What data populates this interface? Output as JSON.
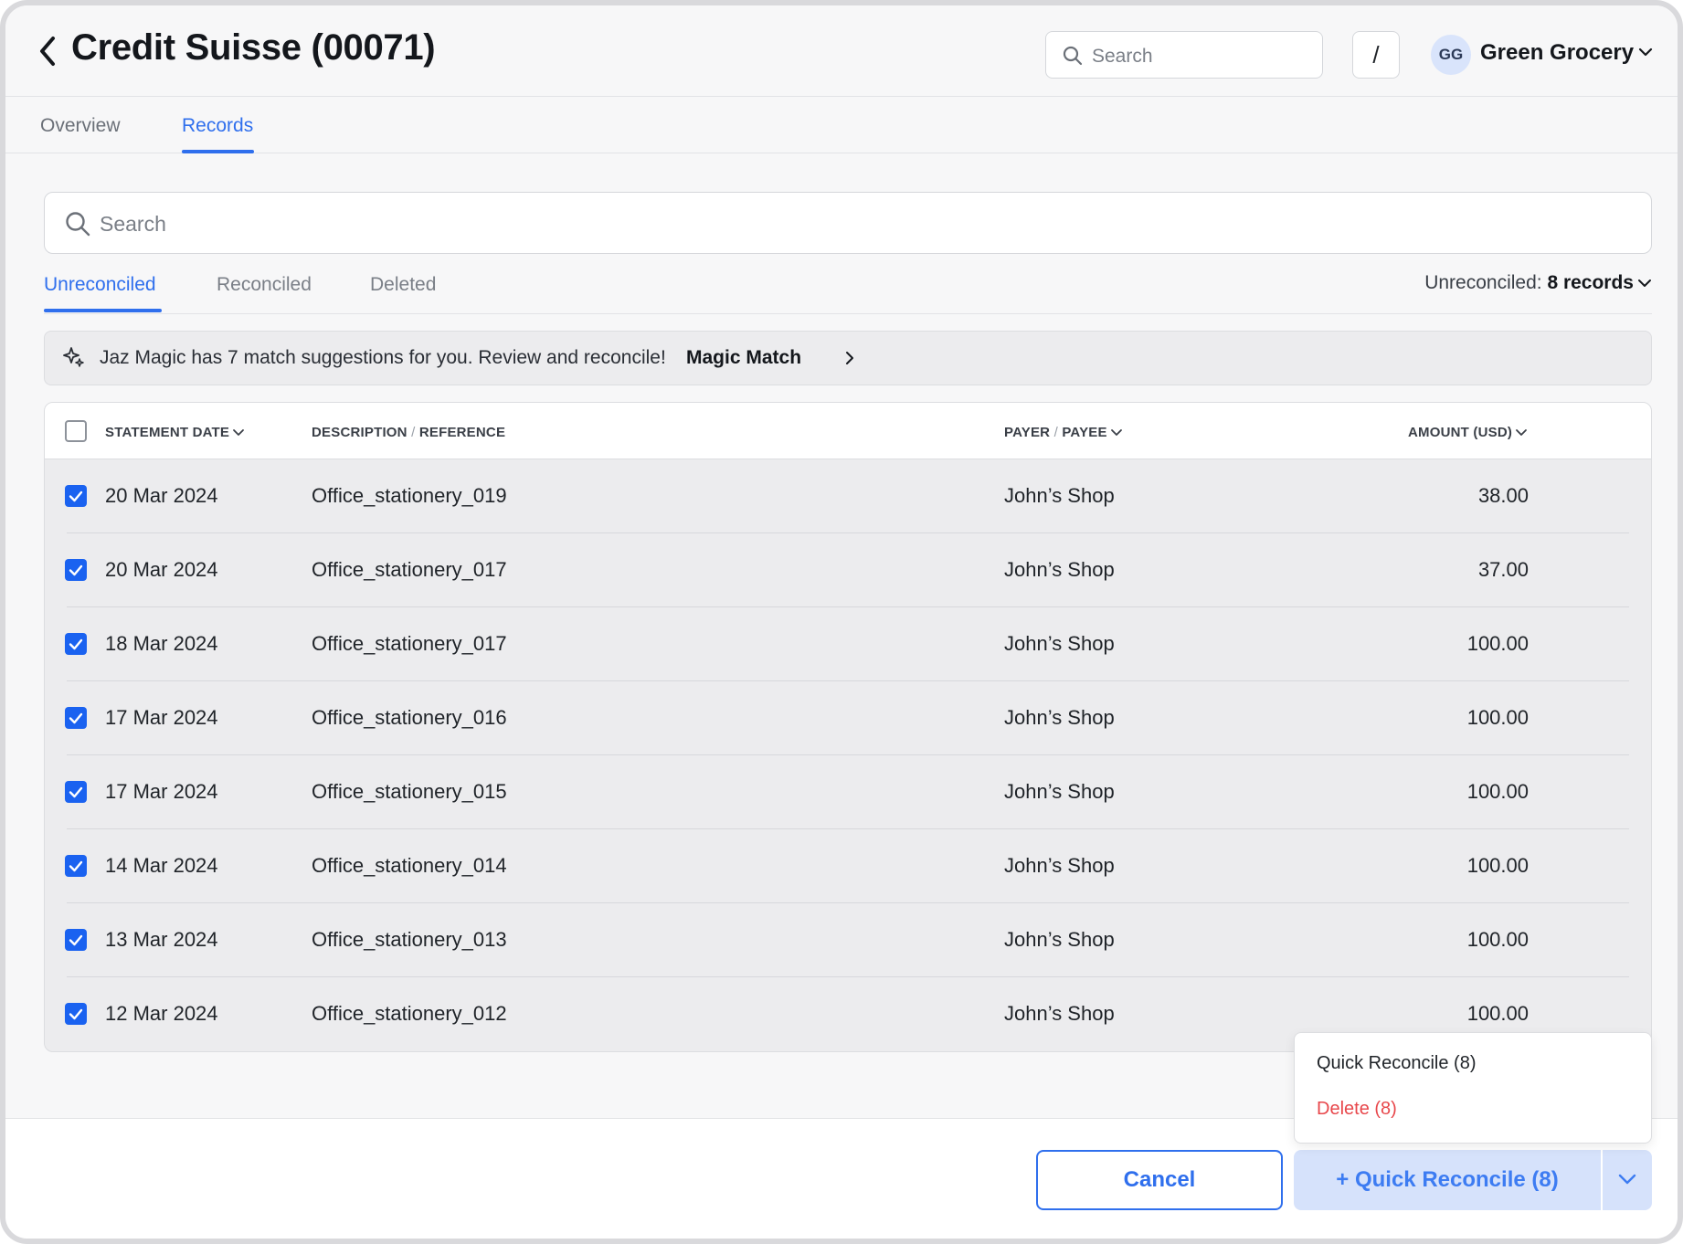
{
  "header": {
    "title": "Credit Suisse (00071)",
    "search_placeholder": "Search",
    "shortcut_key": "/",
    "avatar_initials": "GG",
    "org_name": "Green Grocery"
  },
  "main_tabs": [
    {
      "label": "Overview",
      "active": false
    },
    {
      "label": "Records",
      "active": true
    }
  ],
  "records_search_placeholder": "Search",
  "sub_tabs": [
    {
      "label": "Unreconciled",
      "active": true
    },
    {
      "label": "Reconciled",
      "active": false
    },
    {
      "label": "Deleted",
      "active": false
    }
  ],
  "record_count": {
    "prefix": "Unreconciled: ",
    "value": "8 records"
  },
  "banner": {
    "text": "Jaz Magic has 7 match suggestions for you. Review and reconcile!",
    "link": "Magic Match"
  },
  "table": {
    "columns": {
      "date": "STATEMENT DATE",
      "desc_a": "DESCRIPTION",
      "desc_b": "REFERENCE",
      "payer_a": "PAYER",
      "payer_b": "PAYEE",
      "amount": "AMOUNT (USD)"
    },
    "rows": [
      {
        "date": "20 Mar 2024",
        "description": "Office_stationery_019",
        "payee": "John’s Shop",
        "amount": "38.00",
        "checked": true
      },
      {
        "date": "20 Mar 2024",
        "description": "Office_stationery_017",
        "payee": "John’s Shop",
        "amount": "37.00",
        "checked": true
      },
      {
        "date": "18 Mar 2024",
        "description": "Office_stationery_017",
        "payee": "John’s Shop",
        "amount": "100.00",
        "checked": true
      },
      {
        "date": "17 Mar 2024",
        "description": "Office_stationery_016",
        "payee": "John’s Shop",
        "amount": "100.00",
        "checked": true
      },
      {
        "date": "17 Mar 2024",
        "description": "Office_stationery_015",
        "payee": "John’s Shop",
        "amount": "100.00",
        "checked": true
      },
      {
        "date": "14 Mar 2024",
        "description": "Office_stationery_014",
        "payee": "John’s Shop",
        "amount": "100.00",
        "checked": true
      },
      {
        "date": "13 Mar 2024",
        "description": "Office_stationery_013",
        "payee": "John’s Shop",
        "amount": "100.00",
        "checked": true
      },
      {
        "date": "12 Mar 2024",
        "description": "Office_stationery_012",
        "payee": "John’s Shop",
        "amount": "100.00",
        "checked": true
      }
    ]
  },
  "menu": {
    "quick_reconcile": "Quick Reconcile (8)",
    "delete": "Delete (8)"
  },
  "footer": {
    "cancel": "Cancel",
    "primary": "+ Quick Reconcile (8)"
  },
  "colors": {
    "accent": "#2f6fed",
    "checkbox": "#1a62f0",
    "danger": "#e8474b",
    "primary_disabled_bg": "#d6e2fb"
  },
  "icons": [
    "back-chevron-icon",
    "search-icon",
    "chevron-down-icon",
    "magic-sparkle-icon",
    "chevron-right-icon",
    "checkmark-icon"
  ]
}
